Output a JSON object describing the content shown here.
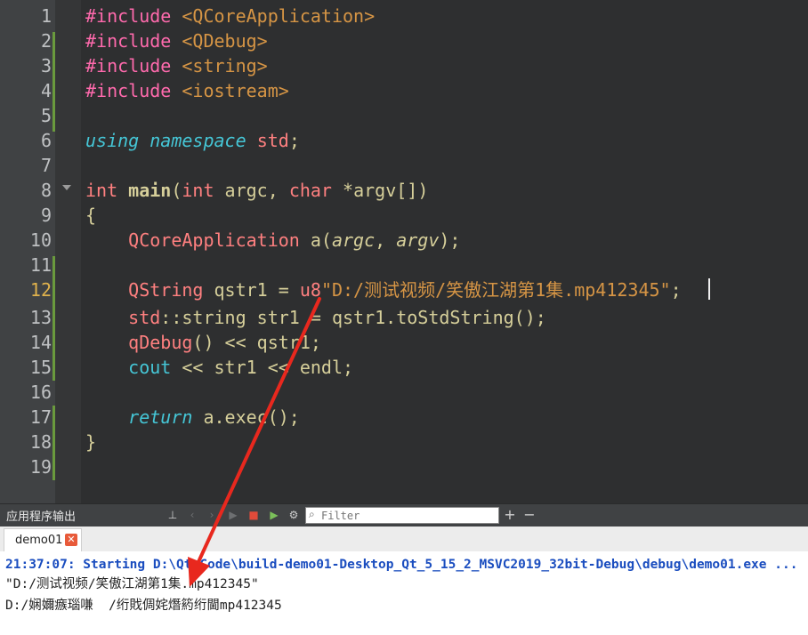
{
  "editor": {
    "line_numbers": [
      "1",
      "2",
      "3",
      "4",
      "5",
      "6",
      "7",
      "8",
      "9",
      "10",
      "11",
      "12",
      "13",
      "14",
      "15",
      "16",
      "17",
      "18",
      "19"
    ],
    "current_line": "12",
    "code": {
      "l1": {
        "pp": "#include",
        "sp": " ",
        "inc": "<QCoreApplication>"
      },
      "l2": {
        "pp": "#include",
        "sp": " ",
        "inc": "<QDebug>"
      },
      "l3": {
        "pp": "#include",
        "sp": " ",
        "inc": "<string>"
      },
      "l4": {
        "pp": "#include",
        "sp": " ",
        "inc": "<iostream>"
      },
      "l6": {
        "kw1": "using",
        "sp1": " ",
        "kw2": "namespace",
        "sp2": " ",
        "name": "std",
        "semi": ";"
      },
      "l8": {
        "t1": "int",
        "sp1": " ",
        "fn": "main",
        "open": "(",
        "t2": "int",
        "rest1": " argc, ",
        "t3": "char",
        "rest2": " *argv[])"
      },
      "l9": {
        "text": "{"
      },
      "l10": {
        "indent": "    ",
        "cls": "QCoreApplication",
        "mid": " a(",
        "p1": "argc",
        "comma": ", ",
        "p2": "argv",
        "end": ");"
      },
      "l12": {
        "indent": "    ",
        "cls": "QString",
        "mid": " qstr1 = ",
        "u8": "u8",
        "str": "\"D:/测试视频/笑傲江湖第1集.mp412345\"",
        "end": ";"
      },
      "l13": {
        "indent": "    ",
        "kw": "std",
        "rest": "::string str1 = qstr1.toStdString();"
      },
      "l14": {
        "indent": "    ",
        "fn": "qDebug",
        "rest": "() << qstr1;"
      },
      "l15": {
        "indent": "    ",
        "kw": "cout",
        "rest": " << str1 << endl;"
      },
      "l17": {
        "indent": "    ",
        "kw": "return",
        "rest": " a.exec();"
      },
      "l18": {
        "text": "}"
      }
    }
  },
  "output": {
    "title": "应用程序输出",
    "filter_placeholder": "Filter",
    "tab_label": "demo01",
    "lines": {
      "start": "21:37:07: Starting D:\\Qt_Code\\build-demo01-Desktop_Qt_5_15_2_MSVC2019_32bit-Debug\\debug\\demo01.exe ...",
      "o1": "\"D:/测试视频/笑傲江湖第1集.mp412345\"",
      "o2": "D:/娴嬭瘯瑙嗛  /绗戝倜姹熸箹绗閫mp412345"
    },
    "toolbar_icons": [
      "attach-icon",
      "prev-icon",
      "next-icon",
      "run-icon",
      "stop-icon",
      "debug-run-icon",
      "settings-icon",
      "filter-icon",
      "zoom-in-icon",
      "zoom-out-icon"
    ]
  },
  "colors": {
    "annotation_arrow": "#e8281e",
    "editor_bg": "#2e2f30",
    "gutter_bg": "#404244"
  }
}
